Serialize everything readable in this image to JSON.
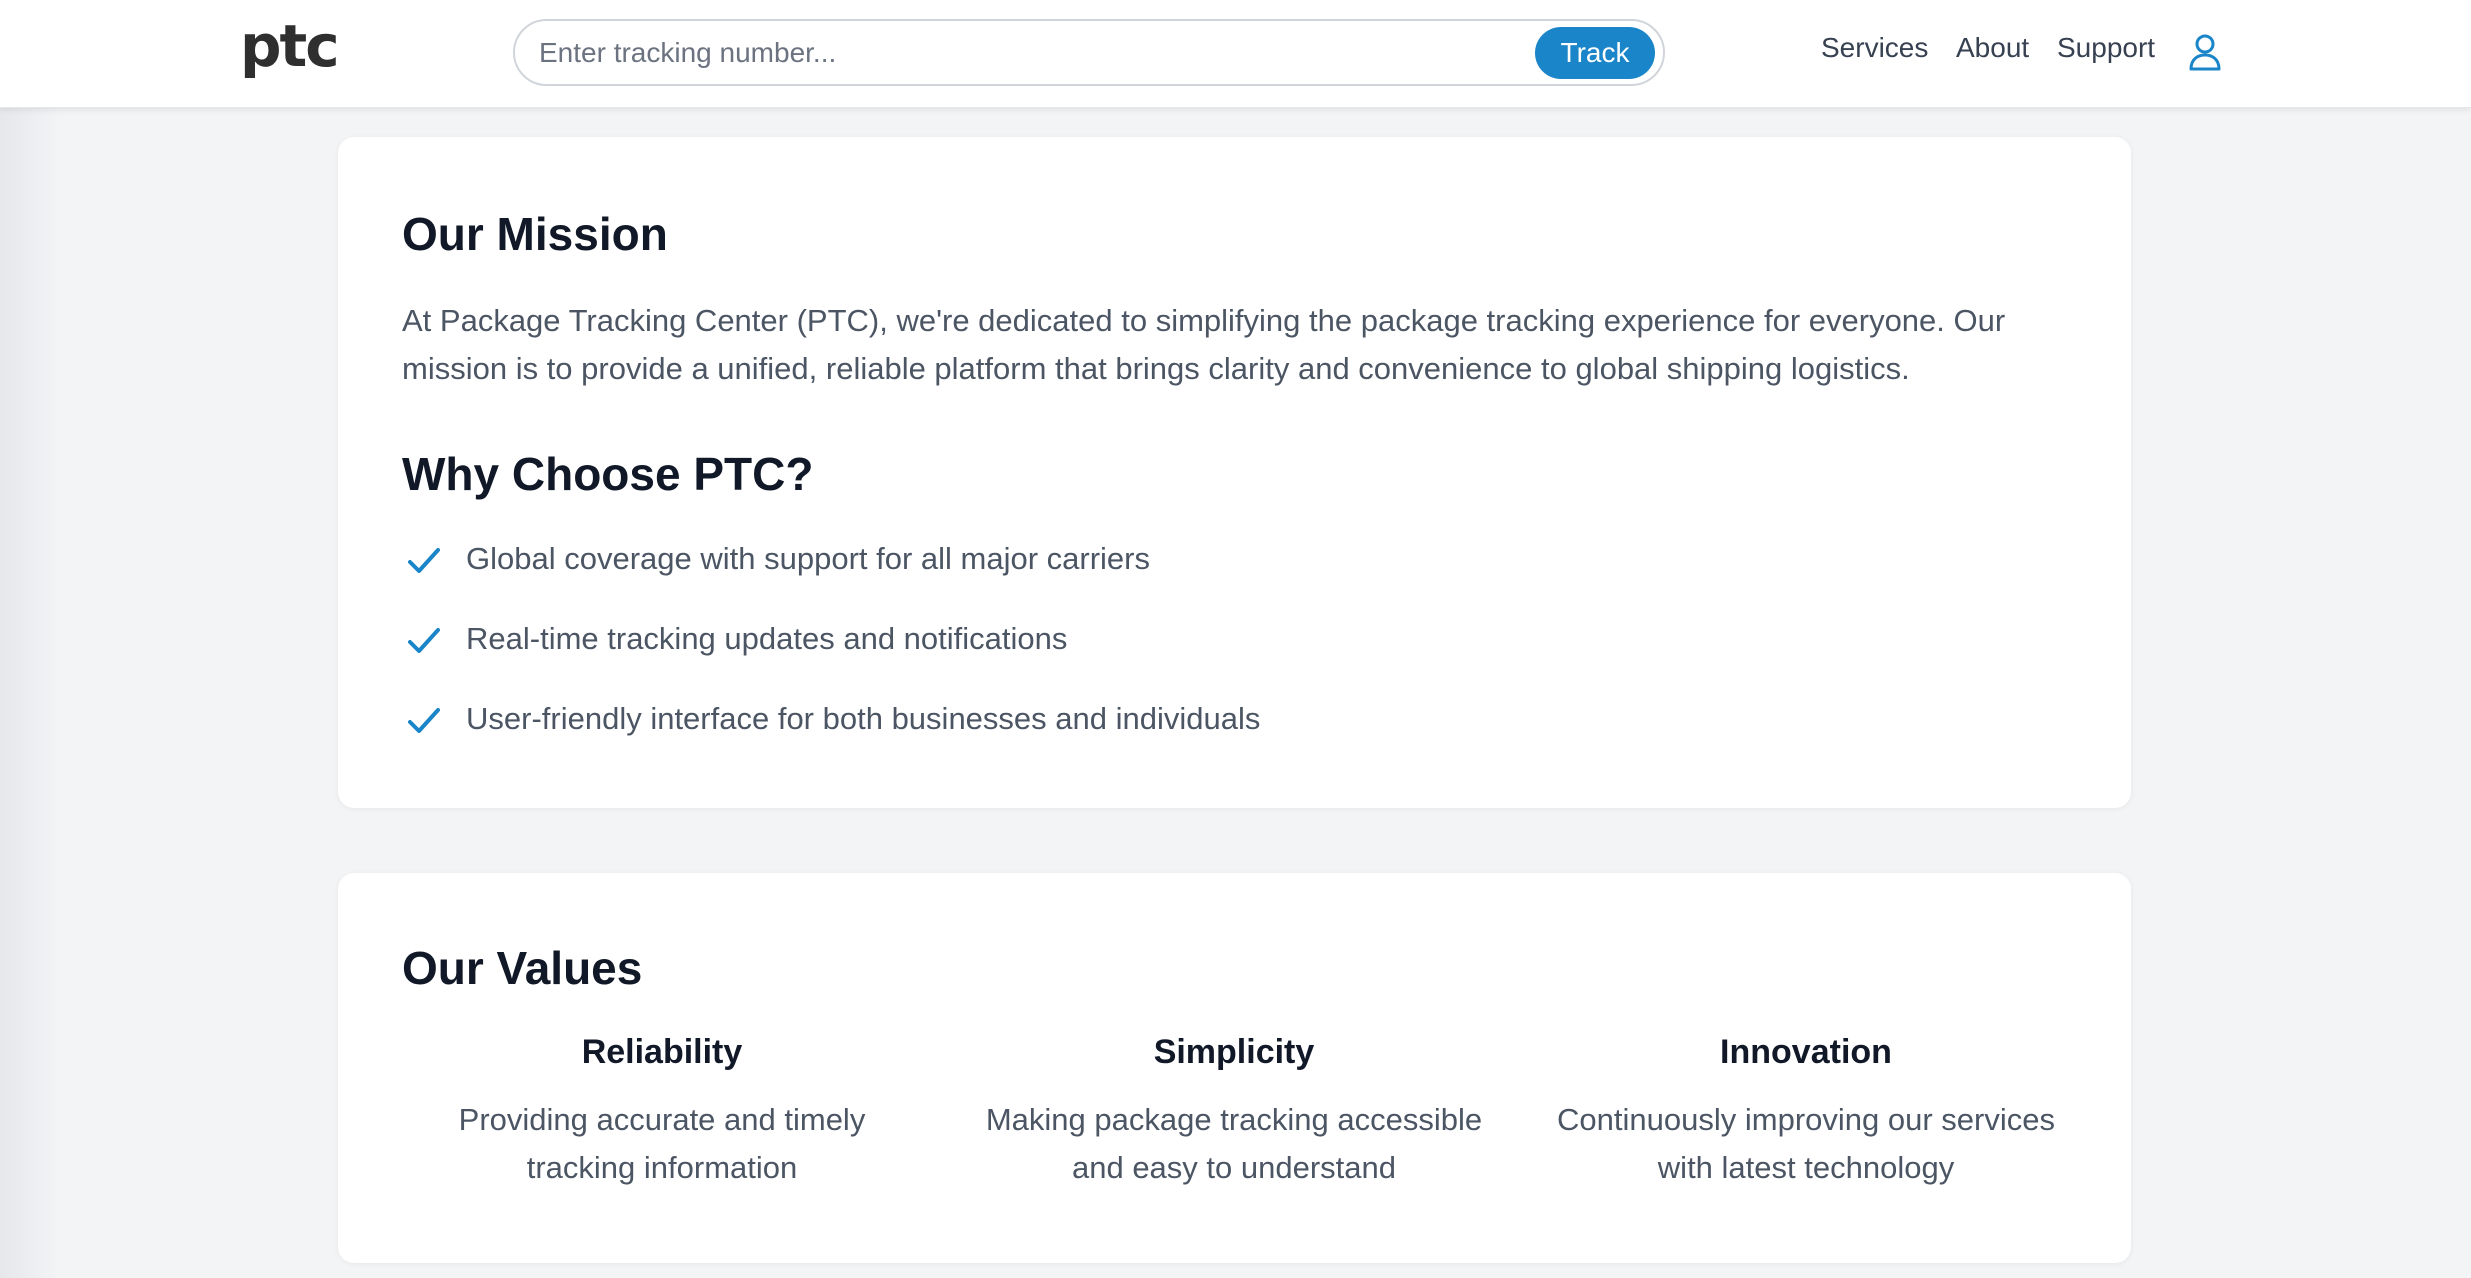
{
  "header": {
    "logo_text": "ptc",
    "search": {
      "placeholder": "Enter tracking number...",
      "value": ""
    },
    "track_label": "Track",
    "nav": {
      "services": "Services",
      "about": "About",
      "support": "Support"
    },
    "user_icon": "user-icon"
  },
  "mission": {
    "title": "Our Mission",
    "text": "At Package Tracking Center (PTC), we're dedicated to simplifying the package tracking experience for everyone. Our mission is to provide a unified, reliable platform that brings clarity and convenience to global shipping logistics."
  },
  "why": {
    "title": "Why Choose PTC?",
    "icon": "check-icon",
    "items": [
      "Global coverage with support for all major carriers",
      "Real-time tracking updates and notifications",
      "User-friendly interface for both businesses and individuals"
    ]
  },
  "values": {
    "title": "Our Values",
    "items": [
      {
        "title": "Reliability",
        "text": "Providing accurate and timely tracking information"
      },
      {
        "title": "Simplicity",
        "text": "Making package tracking accessible and easy to understand"
      },
      {
        "title": "Innovation",
        "text": "Continuously improving our services with latest technology"
      }
    ]
  },
  "colors": {
    "accent": "#1a85c8",
    "heading": "#111827",
    "body_text": "#4b5563",
    "background": "#f3f4f6",
    "logo": "#2f2f2f"
  }
}
